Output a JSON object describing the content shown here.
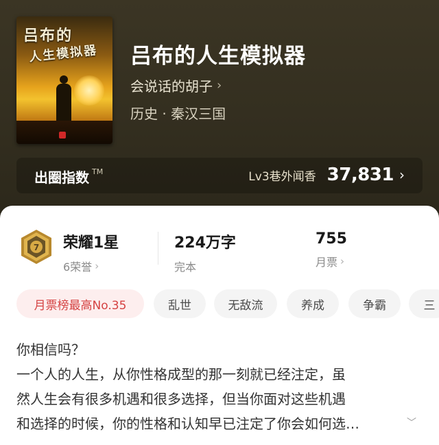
{
  "book": {
    "cover_title_line1": "吕布的",
    "cover_title_line2": "人生模拟器",
    "title": "吕布的人生模拟器",
    "author": "会说话的胡子",
    "genre": "历史 · 秦汉三国"
  },
  "index": {
    "label": "出圈指数",
    "trademark": "TM",
    "level": "Lv3巷外闻香",
    "value": "37,831"
  },
  "stats": {
    "honor": {
      "title": "荣耀1星",
      "sub": "6荣誉",
      "medal_number": "7"
    },
    "words": {
      "value": "224万字",
      "sub": "完本"
    },
    "tickets": {
      "value": "755",
      "sub": "月票"
    }
  },
  "tags": [
    "月票榜最高No.35",
    "乱世",
    "无敌流",
    "养成",
    "争霸",
    "三"
  ],
  "description": {
    "lines": [
      "你相信吗？",
      "一个人的人生，从你性格成型的那一刻就已经注定，虽",
      "然人生会有很多机遇和很多选择，但当你面对这些机遇",
      "和选择的时候，你的性格和认知早已注定了你会如何选…"
    ]
  },
  "colors": {
    "hero_bg": "#342f20",
    "hot_tag_text": "#d54242",
    "hot_tag_bg": "#fdeeee",
    "medal_gold": "#c99a3a"
  }
}
